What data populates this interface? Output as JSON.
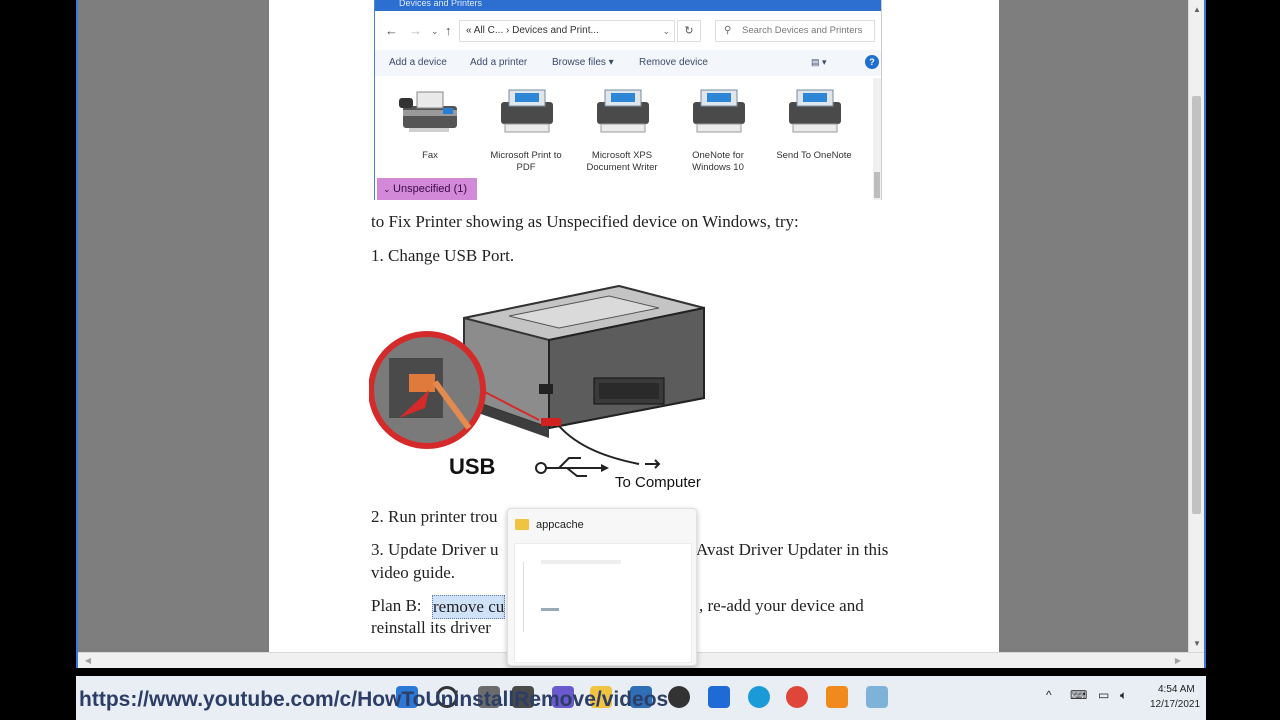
{
  "explorer": {
    "title": "Devices and Printers",
    "address": "« All C... › Devices and Print...",
    "search_placeholder": "Search Devices and Printers",
    "commands": [
      "Add a device",
      "Add a printer",
      "Browse files ▾",
      "Remove device"
    ],
    "devices": [
      {
        "label": "Fax"
      },
      {
        "label": "Microsoft Print to PDF"
      },
      {
        "label": "Microsoft XPS Document Writer"
      },
      {
        "label": "OneNote for Windows 10"
      },
      {
        "label": "Send To OneNote"
      }
    ],
    "group_label": "Unspecified (1)"
  },
  "article": {
    "intro": "to Fix Printer showing as Unspecified device on Windows, try:",
    "step1": "1. Change USB Port.",
    "usb_label": "USB",
    "to_computer": "To Computer",
    "step2": "2. Run printer trou",
    "step3_a": "3. Update Driver u",
    "step3_b": "Avast Driver Updater in this",
    "step3_c": "video guide.",
    "planb_a": "Plan B:",
    "planb_link": "remove cu",
    "planb_b": ", re-add your device and",
    "planb_c": "reinstall its driver"
  },
  "popup": {
    "title": "appcache"
  },
  "bottom": {
    "url": "https://www.youtube.com/c/HowToUninstallRemove/videos"
  },
  "clock": {
    "time": "4:54 AM",
    "date": "12/17/2021"
  },
  "colors": {
    "unspecified_bg": "#d28ad8",
    "titlebar": "#2d6fd0",
    "link_highlight": "#cfe2f7"
  }
}
